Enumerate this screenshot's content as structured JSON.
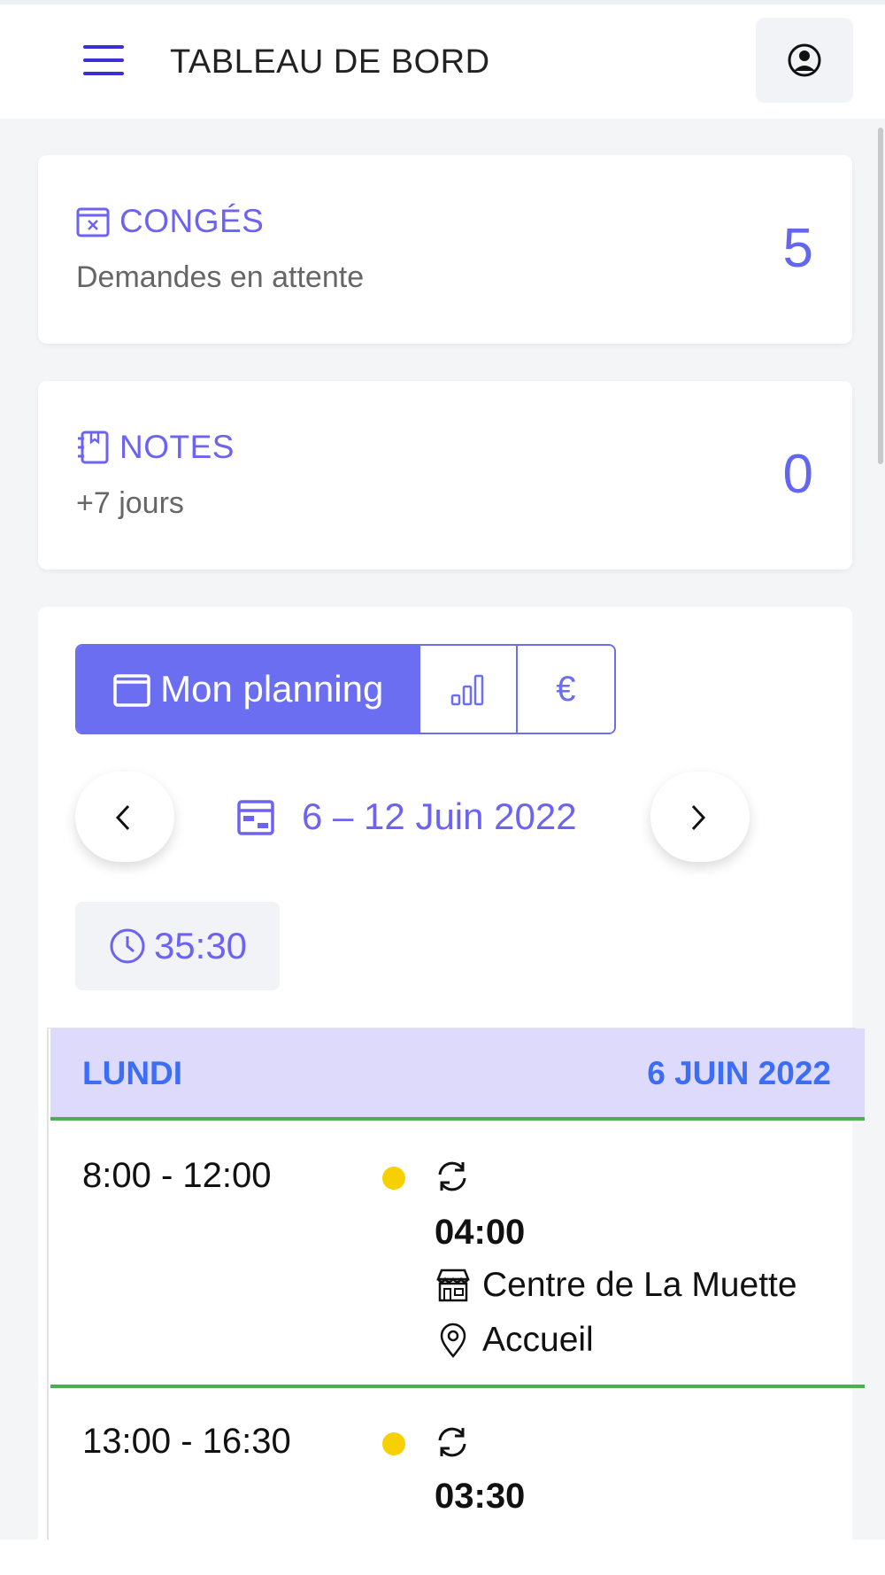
{
  "header": {
    "title": "TABLEAU DE BORD"
  },
  "cards": {
    "conges": {
      "label": "CONGÉS",
      "subtitle": "Demandes en attente",
      "count": "5"
    },
    "notes": {
      "label": "NOTES",
      "subtitle": "+7 jours",
      "count": "0"
    }
  },
  "planning": {
    "tabs": {
      "planning_label": "Mon planning",
      "euro_label": "€"
    },
    "week_label": "6 – 12 Juin 2022",
    "total_hours": "35:30",
    "day": {
      "name": "LUNDI",
      "date": "6 JUIN 2022",
      "slots": [
        {
          "time": "8:00 - 12:00",
          "duration": "04:00",
          "location": "Centre de La Muette",
          "post": "Accueil"
        },
        {
          "time": "13:00 - 16:30",
          "duration": "03:30"
        }
      ]
    }
  },
  "colors": {
    "accent": "#6c6ef2",
    "status_dot": "#f7d000",
    "divider": "#4caf50",
    "day_header_bg": "#dedafb"
  }
}
